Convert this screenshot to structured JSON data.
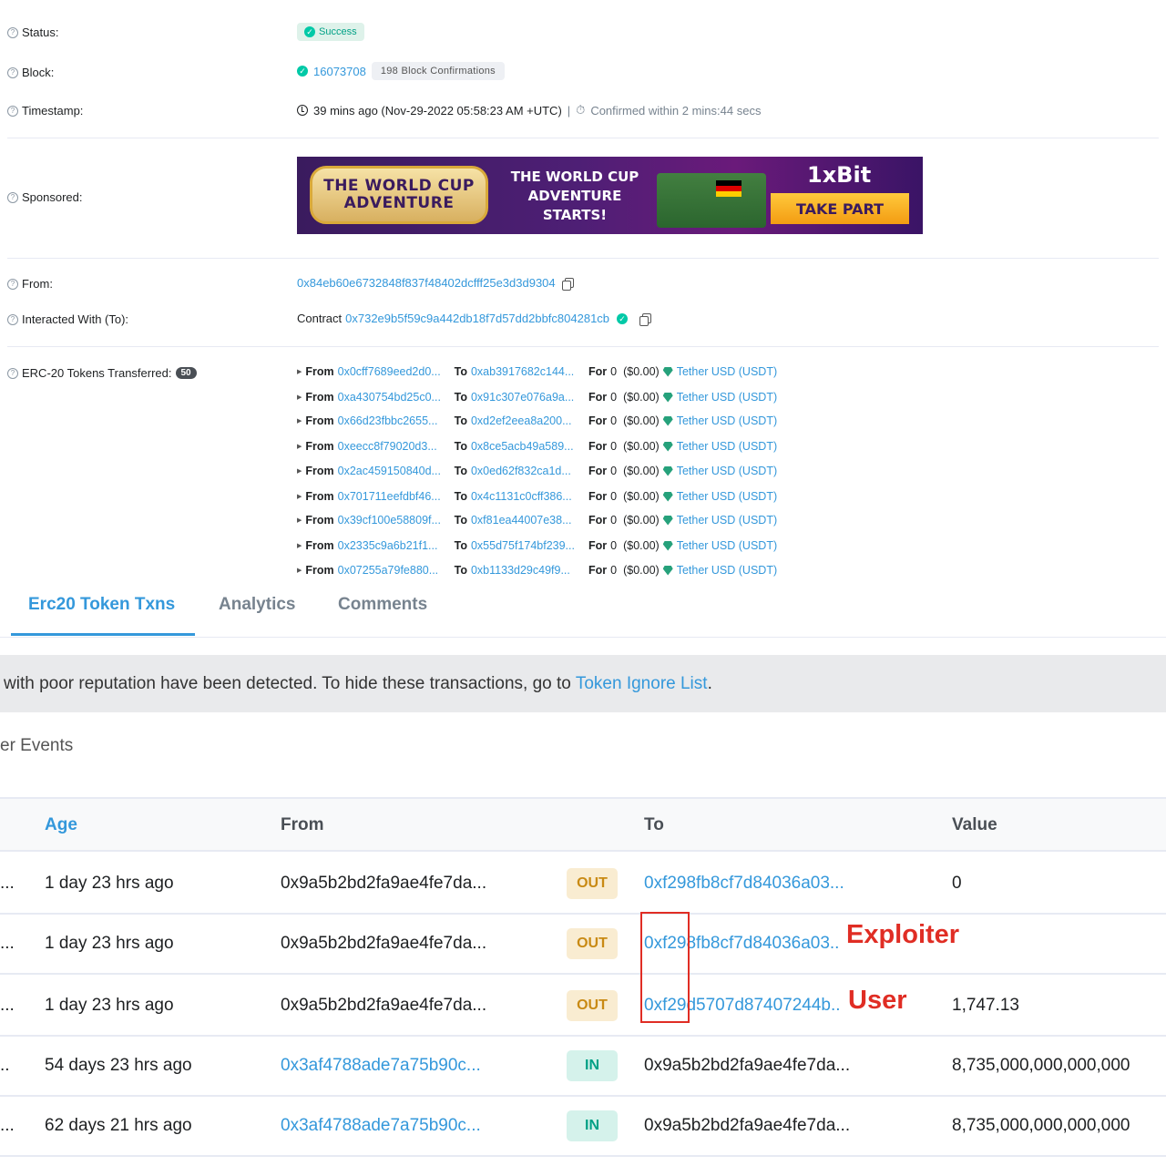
{
  "details": {
    "status": {
      "label": "Status:",
      "value": "Success"
    },
    "block": {
      "label": "Block:",
      "number": "16073708",
      "confirmations": "198 Block Confirmations"
    },
    "timestamp": {
      "label": "Timestamp:",
      "value": "39 mins ago (Nov-29-2022 05:58:23 AM +UTC)",
      "separator": "|",
      "confirmed": "Confirmed within 2 mins:44 secs"
    },
    "sponsored": {
      "label": "Sponsored:",
      "banner": {
        "logo_line1": "THE WORLD CUP",
        "logo_line2": "ADVENTURE",
        "headline_line1": "THE WORLD CUP",
        "headline_line2": "ADVENTURE",
        "headline_line3": "STARTS!",
        "brand": "1xBit",
        "cta": "TAKE PART"
      }
    },
    "from": {
      "label": "From:",
      "address": "0x84eb60e6732848f837f48402dcfff25e3d3d9304"
    },
    "interacted": {
      "label": "Interacted With (To):",
      "prefix": "Contract",
      "address": "0x732e9b5f59c9a442db18f7d57dd2bbfc804281cb"
    },
    "erc20": {
      "label": "ERC-20 Tokens Transferred:",
      "count": "50",
      "from_word": "From",
      "to_word": "To",
      "for_word": "For",
      "transfers": [
        {
          "from": "0x0cff7689eed2d0...",
          "to": "0xab3917682c144...",
          "amount": "0",
          "usd": "($0.00)",
          "token": "Tether USD (USDT)"
        },
        {
          "from": "0xa430754bd25c0...",
          "to": "0x91c307e076a9a...",
          "amount": "0",
          "usd": "($0.00)",
          "token": "Tether USD (USDT)"
        },
        {
          "from": "0x66d23fbbc2655...",
          "to": "0xd2ef2eea8a200...",
          "amount": "0",
          "usd": "($0.00)",
          "token": "Tether USD (USDT)"
        },
        {
          "from": "0xeecc8f79020d3...",
          "to": "0x8ce5acb49a589...",
          "amount": "0",
          "usd": "($0.00)",
          "token": "Tether USD (USDT)"
        },
        {
          "from": "0x2ac459150840d...",
          "to": "0x0ed62f832ca1d...",
          "amount": "0",
          "usd": "($0.00)",
          "token": "Tether USD (USDT)"
        },
        {
          "from": "0x701711eefdbf46...",
          "to": "0x4c1131c0cff386...",
          "amount": "0",
          "usd": "($0.00)",
          "token": "Tether USD (USDT)"
        },
        {
          "from": "0x39cf100e58809f...",
          "to": "0xf81ea44007e38...",
          "amount": "0",
          "usd": "($0.00)",
          "token": "Tether USD (USDT)"
        },
        {
          "from": "0x2335c9a6b21f1...",
          "to": "0x55d75f174bf239...",
          "amount": "0",
          "usd": "($0.00)",
          "token": "Tether USD (USDT)"
        },
        {
          "from": "0x07255a79fe880...",
          "to": "0xb1133d29c49f9...",
          "amount": "0",
          "usd": "($0.00)",
          "token": "Tether USD (USDT)"
        }
      ]
    }
  },
  "tabs": [
    "Erc20 Token Txns",
    "Analytics",
    "Comments"
  ],
  "warning": {
    "text": "with poor reputation have been detected. To hide these transactions, go to ",
    "link": "Token Ignore List",
    "end": "."
  },
  "section_title": "er Events",
  "table": {
    "headers": {
      "age": "Age",
      "from": "From",
      "to": "To",
      "value": "Value"
    },
    "rows": [
      {
        "lead": "...",
        "age": "1 day 23 hrs ago",
        "from": "0x9a5b2bd2fa9ae4fe7da...",
        "from_link": false,
        "dir": "OUT",
        "to": "0xf298fb8cf7d84036a03...",
        "to_link": true,
        "value": "0"
      },
      {
        "lead": "...",
        "age": "1 day 23 hrs ago",
        "from": "0x9a5b2bd2fa9ae4fe7da...",
        "from_link": false,
        "dir": "OUT",
        "to": "0xf298fb8cf7d84036a03..",
        "to_link": true,
        "value": ""
      },
      {
        "lead": "...",
        "age": "1 day 23 hrs ago",
        "from": "0x9a5b2bd2fa9ae4fe7da...",
        "from_link": false,
        "dir": "OUT",
        "to": "0xf29d5707d87407244b..",
        "to_link": true,
        "value": "1,747.13"
      },
      {
        "lead": "..",
        "age": "54 days 23 hrs ago",
        "from": "0x3af4788ade7a75b90c...",
        "from_link": true,
        "dir": "IN",
        "to": "0x9a5b2bd2fa9ae4fe7da...",
        "to_link": false,
        "value": "8,735,000,000,000,000"
      },
      {
        "lead": "...",
        "age": "62 days 21 hrs ago",
        "from": "0x3af4788ade7a75b90c...",
        "from_link": true,
        "dir": "IN",
        "to": "0x9a5b2bd2fa9ae4fe7da...",
        "to_link": false,
        "value": "8,735,000,000,000,000"
      }
    ]
  },
  "annotations": {
    "exploiter": "Exploiter",
    "user": "User"
  },
  "colors": {
    "link": "#3498db",
    "annotation_red": "#e02d24",
    "success": "#00a186",
    "out_badge": "#c98a14",
    "in_badge": "#00a186"
  }
}
